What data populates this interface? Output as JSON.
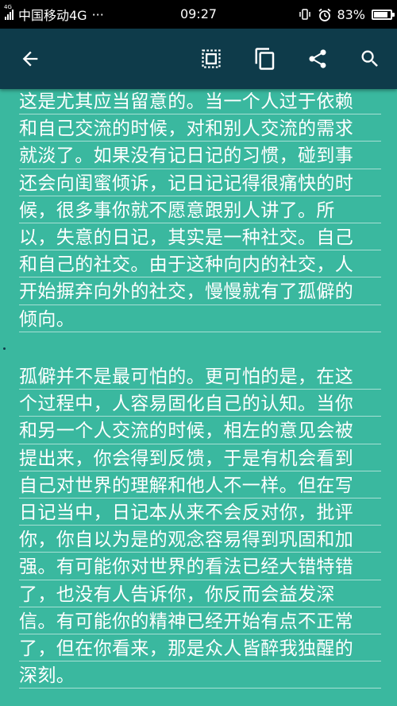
{
  "status_bar": {
    "network_badge": "4G",
    "carrier": "中国移动4G",
    "more": "···",
    "time": "09:27",
    "battery_percent": "83%",
    "battery_level": 0.83,
    "icons": [
      "signal-icon",
      "vibrate-icon",
      "alarm-icon",
      "battery-icon"
    ]
  },
  "toolbar": {
    "back_icon": "arrow-left-icon",
    "actions": [
      "select-all-icon",
      "copy-icon",
      "share-icon",
      "search-icon"
    ]
  },
  "reader": {
    "background": "#3ab89f",
    "toolbar_color": "#0e3b4a",
    "text_color": "#ffffff",
    "paragraphs": [
      {
        "lines": [
          "这是尤其应当留意的。当一个人过于依赖",
          "和自己交流的时候，对和别人交流的需求",
          "就淡了。如果没有记日记的习惯，碰到事",
          "还会向闺蜜倾诉，记日记记得很痛快的时",
          "候，很多事你就不愿意跟别人讲了。所",
          "以，失意的日记，其实是一种社交。自己",
          "和自己的社交。由于这种向内的社交，人",
          "开始摒弃向外的社交，慢慢就有了孤僻的",
          "倾向。"
        ]
      },
      {
        "lines": [
          "孤僻并不是最可怕的。更可怕的是，在这",
          "个过程中，人容易固化自己的认知。当你",
          "和另一个人交流的时候，相左的意见会被",
          "提出来，你会得到反馈，于是有机会看到",
          "自己对世界的理解和他人不一样。但在写",
          "日记当中，日记本从来不会反对你，批评",
          "你，你自以为是的观念容易得到巩固和加",
          "强。有可能你对世界的看法已经大错特错",
          "了，也没有人告诉你，你反而会益发深",
          "信。有可能你的精神已经开始有点不正常",
          "了，但在你看来，那是众人皆醉我独醒的",
          "深刻。"
        ]
      }
    ]
  }
}
